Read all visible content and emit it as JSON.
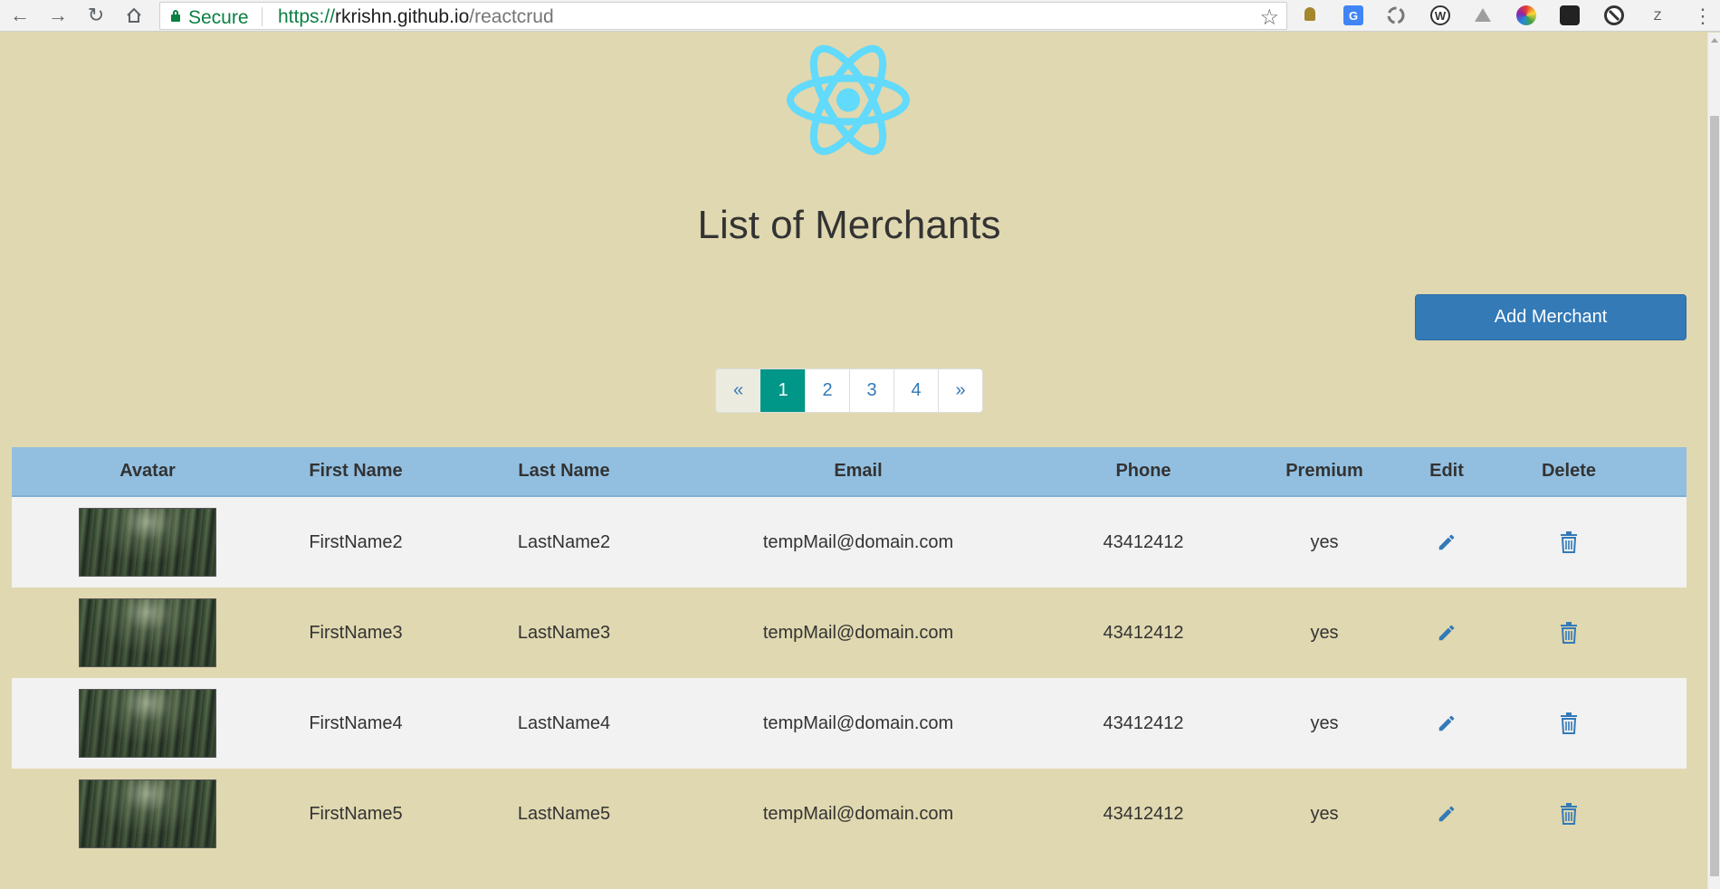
{
  "browser": {
    "security_label": "Secure",
    "url_scheme": "https://",
    "url_host": "rkrishn.github.io",
    "url_path": "/reactcrud",
    "extensions": [
      "android-icon",
      "translate-icon",
      "sync-icon",
      "wordpress-icon",
      "drive-icon",
      "color-picker-icon",
      "spy-icon",
      "block-icon",
      "z-icon"
    ],
    "extension_z_label": "Z"
  },
  "page": {
    "title": "List of Merchants",
    "add_button_label": "Add Merchant",
    "logo_color": "#61dafb"
  },
  "pagination": {
    "prev": "«",
    "pages": [
      "1",
      "2",
      "3",
      "4"
    ],
    "active": "1",
    "next": "»"
  },
  "table": {
    "headers": [
      "Avatar",
      "First Name",
      "Last Name",
      "Email",
      "Phone",
      "Premium",
      "Edit",
      "Delete"
    ],
    "rows": [
      {
        "first_name": "FirstName2",
        "last_name": "LastName2",
        "email": "tempMail@domain.com",
        "phone": "43412412",
        "premium": "yes"
      },
      {
        "first_name": "FirstName3",
        "last_name": "LastName3",
        "email": "tempMail@domain.com",
        "phone": "43412412",
        "premium": "yes"
      },
      {
        "first_name": "FirstName4",
        "last_name": "LastName4",
        "email": "tempMail@domain.com",
        "phone": "43412412",
        "premium": "yes"
      },
      {
        "first_name": "FirstName5",
        "last_name": "LastName5",
        "email": "tempMail@domain.com",
        "phone": "43412412",
        "premium": "yes"
      }
    ]
  },
  "colors": {
    "page_background": "#e0d8b0",
    "header_background": "#92bfe0",
    "primary_button": "#337ab7",
    "active_page": "#009688",
    "icon_color": "#337ab7"
  }
}
